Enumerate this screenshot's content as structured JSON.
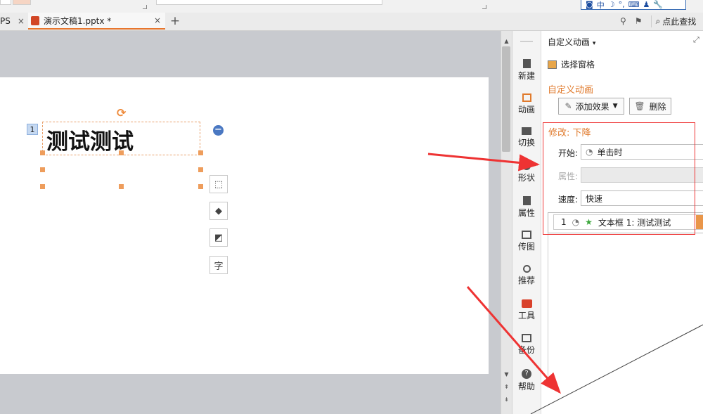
{
  "ime_toolbar": {
    "lang": "中"
  },
  "tabs": {
    "wps_label": "PS",
    "doc_label": "演示文稿1.pptx *",
    "close_glyph": "×",
    "add_glyph": "+",
    "search_label": "点此查找"
  },
  "slide": {
    "anim_order": "1",
    "text": "测试测试"
  },
  "sidebar": {
    "items": [
      {
        "label": "新建",
        "icon": "new-file-icon"
      },
      {
        "label": "动画",
        "icon": "animation-icon"
      },
      {
        "label": "切换",
        "icon": "transition-icon"
      },
      {
        "label": "形状",
        "icon": "shape-icon"
      },
      {
        "label": "属性",
        "icon": "property-icon"
      },
      {
        "label": "传图",
        "icon": "upload-image-icon"
      },
      {
        "label": "推荐",
        "icon": "recommend-icon"
      },
      {
        "label": "工具",
        "icon": "toolbox-icon"
      },
      {
        "label": "备份",
        "icon": "backup-icon"
      },
      {
        "label": "帮助",
        "icon": "help-icon"
      }
    ]
  },
  "pane": {
    "title": "自定义动画",
    "select_pane_label": "选择窗格",
    "section_title": "自定义动画",
    "add_effect_label": "添加效果",
    "delete_label": "删除",
    "modify_title": "修改: 下降",
    "start_label": "开始:",
    "start_value": "单击时",
    "property_label": "属性:",
    "speed_label": "速度:",
    "speed_value": "快速",
    "list_item": {
      "order": "1",
      "name": "文本框 1: 测试测试"
    }
  },
  "colors": {
    "accent": "#e07a2c",
    "annotation": "#e33333",
    "ppt_icon": "#d24726"
  }
}
